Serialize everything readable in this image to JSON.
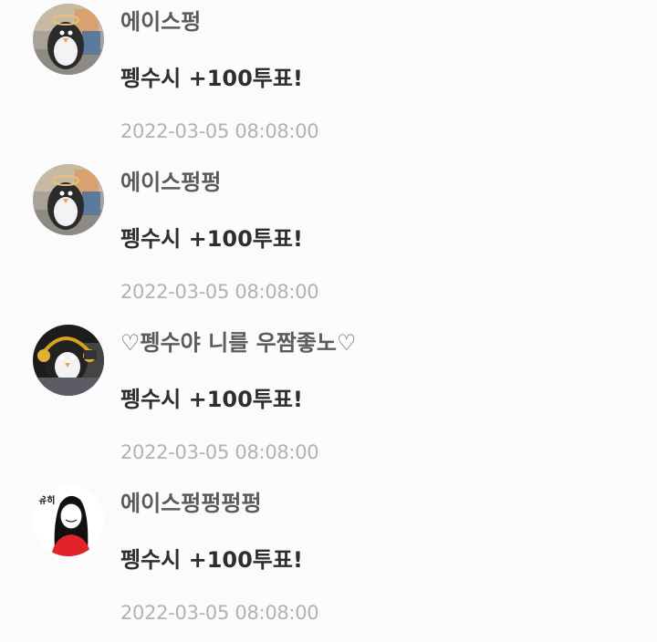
{
  "comments": [
    {
      "avatar_icon": "penguin-avatar-icon",
      "username": "에이스펑",
      "text": "펭수시 +100투표!",
      "timestamp": "2022-03-05 08:08:00"
    },
    {
      "avatar_icon": "penguin-avatar-icon",
      "username": "에이스펑펑",
      "text": "펭수시 +100투표!",
      "timestamp": "2022-03-05 08:08:00"
    },
    {
      "avatar_icon": "penguin-headphones-avatar-icon",
      "username": "♡펭수야 니를 우짬좋노♡",
      "text": "펭수시 +100투표!",
      "timestamp": "2022-03-05 08:08:00"
    },
    {
      "avatar_icon": "girl-drawing-avatar-icon",
      "avatar_caption": "유히",
      "username": "에이스펑펑펑펑",
      "text": "펭수시 +100투표!",
      "timestamp": "2022-03-05 08:08:00"
    }
  ],
  "colors": {
    "background": "#fbfbfb",
    "username": "#5b5b5b",
    "text": "#2e2e2e",
    "timestamp": "#b2b2b2"
  }
}
